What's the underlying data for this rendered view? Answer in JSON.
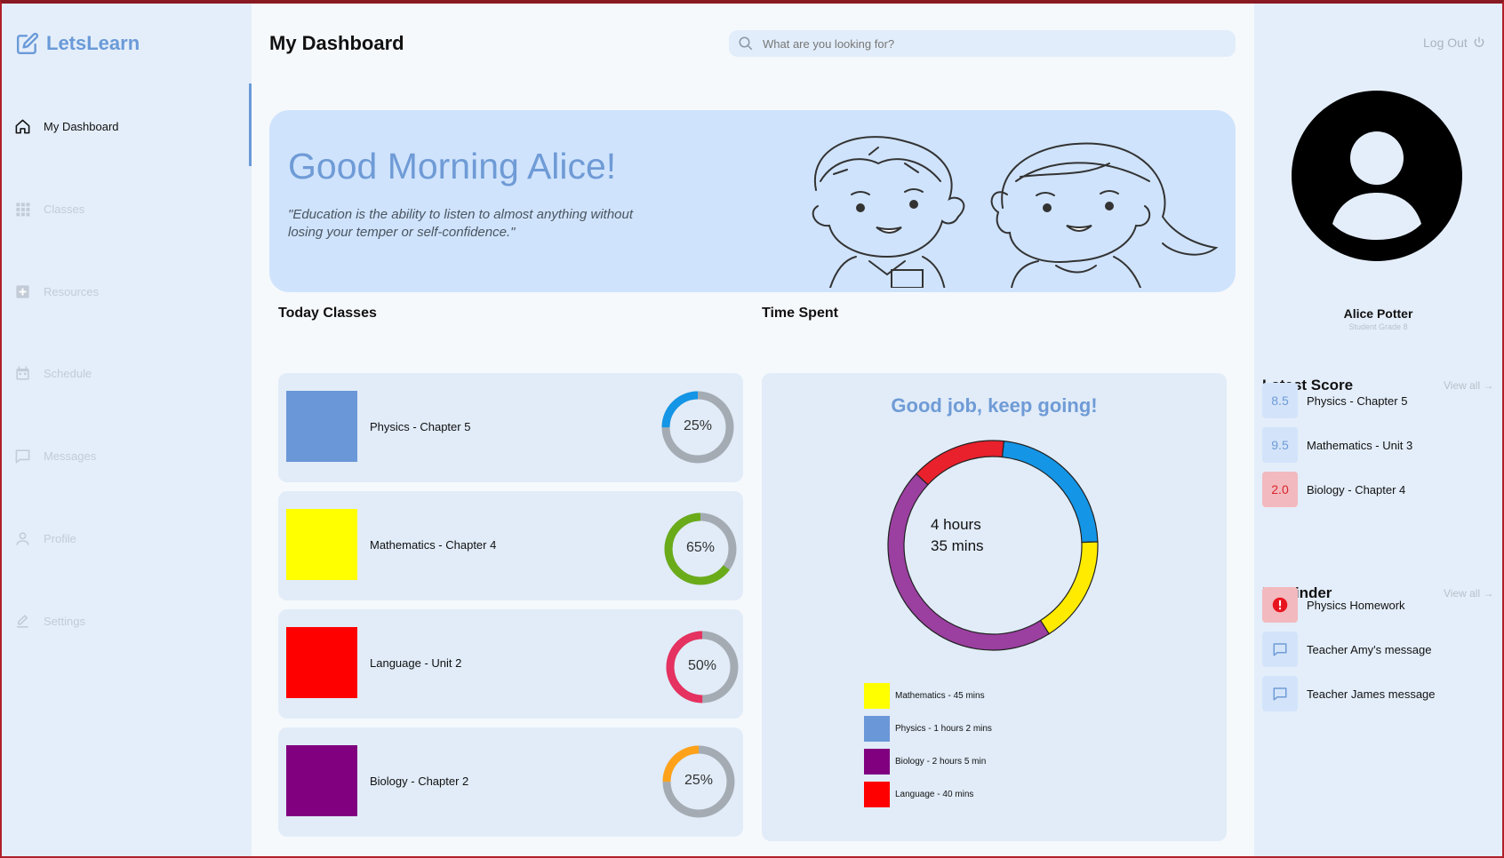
{
  "app": {
    "name": "LetsLearn",
    "logo_icon": "edit-icon"
  },
  "sidebar": {
    "items": [
      {
        "label": "My Dashboard",
        "icon": "home-icon",
        "active": true
      },
      {
        "label": "Classes",
        "icon": "grid-icon",
        "active": false
      },
      {
        "label": "Resources",
        "icon": "plus-box-icon",
        "active": false
      },
      {
        "label": "Schedule",
        "icon": "calendar-icon",
        "active": false
      },
      {
        "label": "Messages",
        "icon": "chat-icon",
        "active": false
      },
      {
        "label": "Profile",
        "icon": "person-icon",
        "active": false
      },
      {
        "label": "Settings",
        "icon": "pencil-icon",
        "active": false
      }
    ]
  },
  "header": {
    "title": "My Dashboard",
    "search_placeholder": "What are you looking for?",
    "logout_label": "Log Out"
  },
  "banner": {
    "greeting": "Good Morning Alice!",
    "quote": "\"Education is the ability to listen to almost anything without losing your temper or self-confidence.\""
  },
  "today_classes": {
    "title": "Today Classes",
    "items": [
      {
        "name": "Physics - Chapter 5",
        "color": "#6a97d8",
        "progress": 25,
        "progress_label": "25%",
        "ring_color": "#1495e6"
      },
      {
        "name": "Mathematics - Chapter 4",
        "color": "#ffff00",
        "progress": 65,
        "progress_label": "65%",
        "ring_color": "#6aab1a"
      },
      {
        "name": "Language - Unit 2",
        "color": "#ff0000",
        "progress": 50,
        "progress_label": "50%",
        "ring_color": "#e53260"
      },
      {
        "name": "Biology - Chapter 2",
        "color": "#800080",
        "progress": 25,
        "progress_label": "25%",
        "ring_color": "#ffa21a"
      }
    ],
    "stray_mark": "]"
  },
  "time_spent": {
    "title": "Time Spent",
    "tagline": "Good job, keep going!",
    "total_line1": "4 hours",
    "total_line2": "35 mins"
  },
  "chart_data": {
    "type": "pie",
    "donut": true,
    "categories": [
      "Physics",
      "Mathematics",
      "Biology",
      "Language"
    ],
    "values": [
      62,
      45,
      125,
      40
    ],
    "units": "mins",
    "colors": [
      "#1495e6",
      "#ffeb00",
      "#9b3fa0",
      "#e8212c"
    ],
    "legend": [
      {
        "label": "Mathematics - 45 mins",
        "color": "#ffff00"
      },
      {
        "label": "Physics - 1 hours 2 mins",
        "color": "#6a97d8"
      },
      {
        "label": "Biology - 2 hours 5 min",
        "color": "#800080"
      },
      {
        "label": "Language - 40 mins",
        "color": "#ff0000"
      }
    ]
  },
  "profile": {
    "name": "Alice Potter",
    "role": "Student Grade 8"
  },
  "latest_score": {
    "title": "Latest Score",
    "view_all": "View all →",
    "items": [
      {
        "score": "8.5",
        "subject": "Physics - Chapter 5",
        "status": "good"
      },
      {
        "score": "9.5",
        "subject": "Mathematics - Unit 3",
        "status": "good"
      },
      {
        "score": "2.0",
        "subject": "Biology - Chapter 4",
        "status": "bad"
      }
    ]
  },
  "reminder": {
    "title": "Reminder",
    "view_all": "View all →",
    "items": [
      {
        "label": "Physics Homework",
        "icon": "alert-icon",
        "urgent": true
      },
      {
        "label": "Teacher Amy's message",
        "icon": "message-icon",
        "urgent": false
      },
      {
        "label": "Teacher James message",
        "icon": "message-icon",
        "urgent": false
      }
    ]
  },
  "colors": {
    "accent": "#6f9bd6",
    "sidebar_bg": "#e4eefa",
    "main_bg": "#f6f9fc"
  }
}
